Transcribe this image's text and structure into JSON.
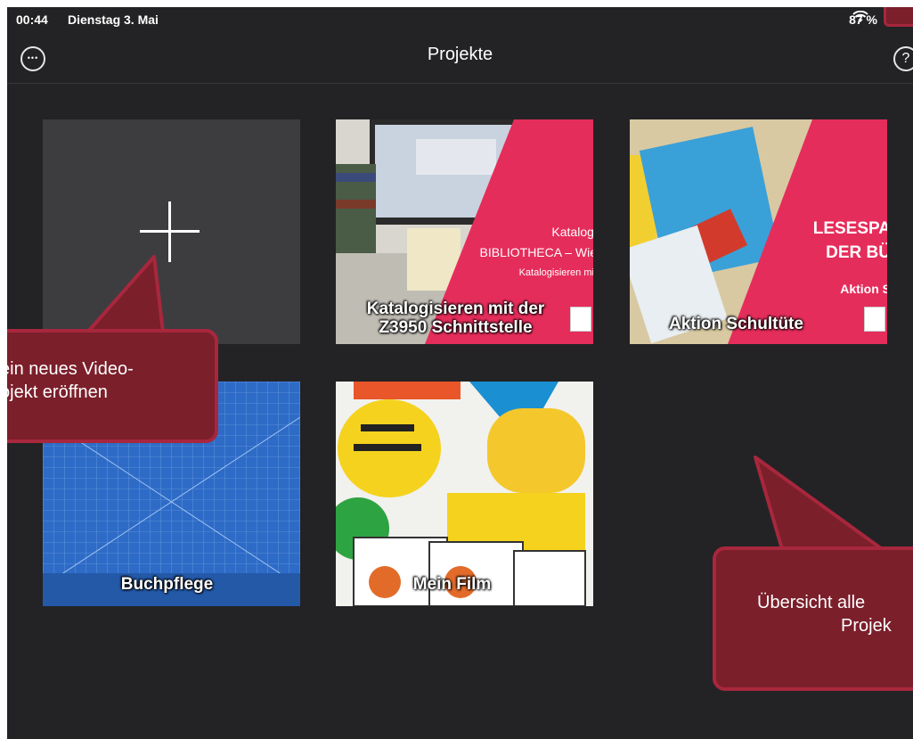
{
  "status": {
    "time": "00:44",
    "date": "Dienstag 3. Mai",
    "battery": "87 %"
  },
  "nav": {
    "title": "Projekte",
    "help_symbol": "?",
    "more_symbol": "•••"
  },
  "projects": [
    {
      "label_line1": "Katalogisieren mit der",
      "label_line2": "Z3950 Schnittstelle",
      "overlay": [
        "Katalogi",
        "BIBLIOTHECA – Wie",
        "Katalogisieren mit"
      ]
    },
    {
      "label": "Aktion Schultüte",
      "overlay": [
        "LESESPA",
        "DER BÜ",
        "Aktion S"
      ]
    },
    {
      "label": "Buchpflege"
    },
    {
      "label": "Mein Film"
    }
  ],
  "callouts": {
    "new_project_line1": "ein neues Video-",
    "new_project_line2": "ojekt eröffnen",
    "overview_line1": "Übersicht alle",
    "overview_line2": "Projek"
  },
  "colors": {
    "background": "#232325",
    "accent_pink": "#e52d5b",
    "callout": "#7b1f2b",
    "callout_border": "#a8273d"
  },
  "icons": {
    "more": "more-icon",
    "help": "help-icon",
    "wifi": "wifi-icon",
    "battery": "battery-icon",
    "plus": "plus-icon"
  }
}
